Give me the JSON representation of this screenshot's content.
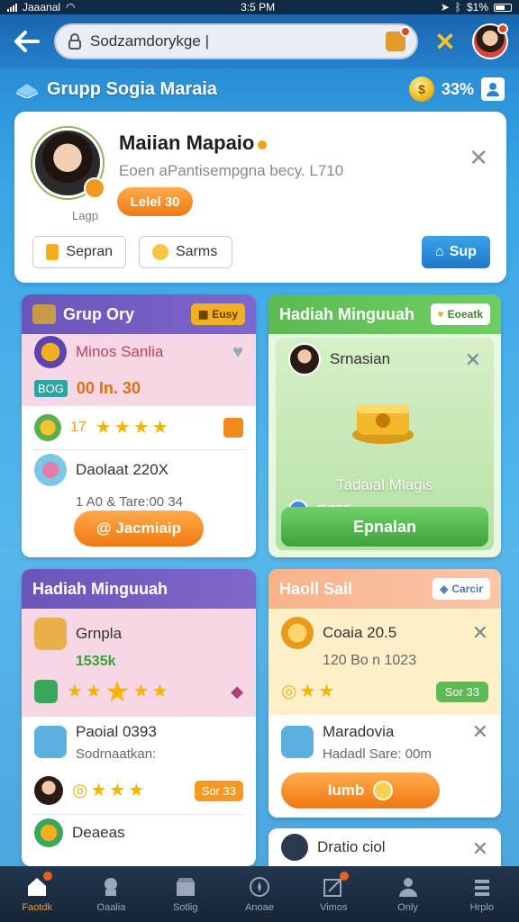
{
  "status_bar": {
    "carrier": "Jaaanal",
    "time": "3:5 PM",
    "battery": "$1%"
  },
  "top_bar": {
    "url": "Sodzamdorykge |"
  },
  "header": {
    "title": "Grupp Sogia Maraia",
    "coins": "33%"
  },
  "profile": {
    "name": "Maiian Mapaio",
    "description": "Eoen aPantisempgna becy. L710",
    "sub": "Lagp",
    "level_button": "Lelel 30",
    "btn1": "Sepran",
    "btn2": "Sarms",
    "sup_button": "Sup"
  },
  "card_group": {
    "title": "Grup Ory",
    "chip": "Eusy",
    "row1_title": "Minos Sanlia",
    "row1_tag": "BOG",
    "row1_value": "00 In. 30",
    "row2_value": "17",
    "row3_title": "Daolaat 220X",
    "row3_sub": "1 A0 & Tare:00 34",
    "button": "@ Jacmiaip"
  },
  "card_hadiah_green": {
    "title": "Hadiah Minguuah",
    "chip": "Eoeatk",
    "user": "Srnasian",
    "item_title": "Tadaial Mlagis",
    "item_sub": "RS55",
    "button": "Epnalan"
  },
  "card_hadiah_purple": {
    "title": "Hadiah Minguuah",
    "row1_title": "Grnpla",
    "row1_value": "1535k",
    "row2_title": "Paoial 0393",
    "row2_sub": "Sodrnaatkan:",
    "row3_chip": "Sor 33",
    "row4_title": "Deaeas"
  },
  "card_haoll": {
    "title": "Haoll Sail",
    "chip": "Carcir",
    "row1_title": "Coaia 20.5",
    "row1_sub": "120 Bo n 1023",
    "row1_chip": "Sor 33",
    "row2_title": "Maradovia",
    "row2_sub": "Hadadl Sare: 00m",
    "button": "Iumb"
  },
  "card_bottom": {
    "title": "Dratio ciol"
  },
  "nav": [
    {
      "label": "Faotdk",
      "icon": "home-icon"
    },
    {
      "label": "Oaalia",
      "icon": "chef-icon"
    },
    {
      "label": "Sotlig",
      "icon": "store-icon"
    },
    {
      "label": "Anoae",
      "icon": "compass-icon"
    },
    {
      "label": "Vimos",
      "icon": "edit-icon"
    },
    {
      "label": "Only",
      "icon": "person-icon"
    },
    {
      "label": "Hrplo",
      "icon": "menu-icon"
    }
  ],
  "colors": {
    "accent_orange": "#f07810",
    "accent_green": "#3ea23a",
    "accent_purple": "#6a55b8",
    "top_bar": "#1a64ad"
  }
}
